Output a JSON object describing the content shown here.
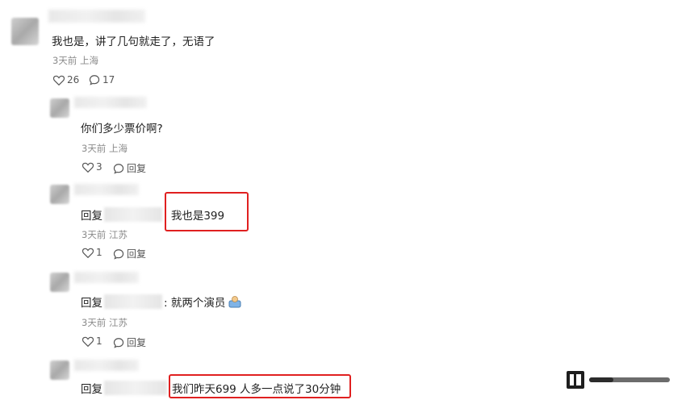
{
  "comments": [
    {
      "text": "我也是，讲了几句就走了，无语了",
      "time": "3天前",
      "location": "上海",
      "likes": "26",
      "replies": "17"
    }
  ],
  "replies": [
    {
      "text": "你们多少票价啊?",
      "time": "3天前",
      "location": "上海",
      "likes": "3",
      "reply_label": "回复"
    },
    {
      "prefix": "回复",
      "text": ": 我也是399",
      "time": "3天前",
      "location": "江苏",
      "likes": "1",
      "reply_label": "回复"
    },
    {
      "prefix": "回复",
      "text": ": 就两个演员",
      "time": "3天前",
      "location": "江苏",
      "likes": "1",
      "reply_label": "回复"
    },
    {
      "prefix": "回复",
      "text": "我们昨天699 人多一点说了30分钟"
    }
  ],
  "colors": {
    "highlight": "#e02020",
    "meta": "#8a8a8a"
  }
}
